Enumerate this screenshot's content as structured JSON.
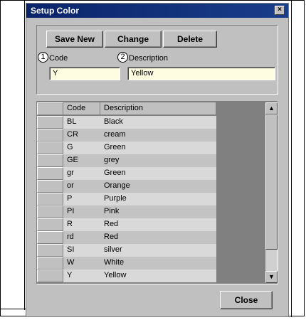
{
  "window": {
    "title": "Setup Color",
    "close_glyph": "×"
  },
  "toolbar": {
    "save_new_label": "Save New",
    "change_label": "Change",
    "delete_label": "Delete"
  },
  "form": {
    "code_badge": "1",
    "code_label": "Code",
    "code_value": "Y",
    "desc_badge": "2",
    "desc_label": "Description",
    "desc_value": "Yellow"
  },
  "table": {
    "columns": [
      "Code",
      "Description"
    ],
    "rows": [
      {
        "code": "BL",
        "description": "Black"
      },
      {
        "code": "CR",
        "description": "cream"
      },
      {
        "code": "G",
        "description": "Green"
      },
      {
        "code": "GE",
        "description": "grey"
      },
      {
        "code": "gr",
        "description": "Green"
      },
      {
        "code": "or",
        "description": "Orange"
      },
      {
        "code": "P",
        "description": "Purple"
      },
      {
        "code": "PI",
        "description": "Pink"
      },
      {
        "code": "R",
        "description": "Red"
      },
      {
        "code": "rd",
        "description": "Red"
      },
      {
        "code": "SI",
        "description": "silver"
      },
      {
        "code": "W",
        "description": "White"
      },
      {
        "code": "Y",
        "description": "Yellow"
      }
    ]
  },
  "scroll": {
    "up_glyph": "▲",
    "down_glyph": "▼"
  },
  "footer": {
    "close_label": "Close"
  }
}
